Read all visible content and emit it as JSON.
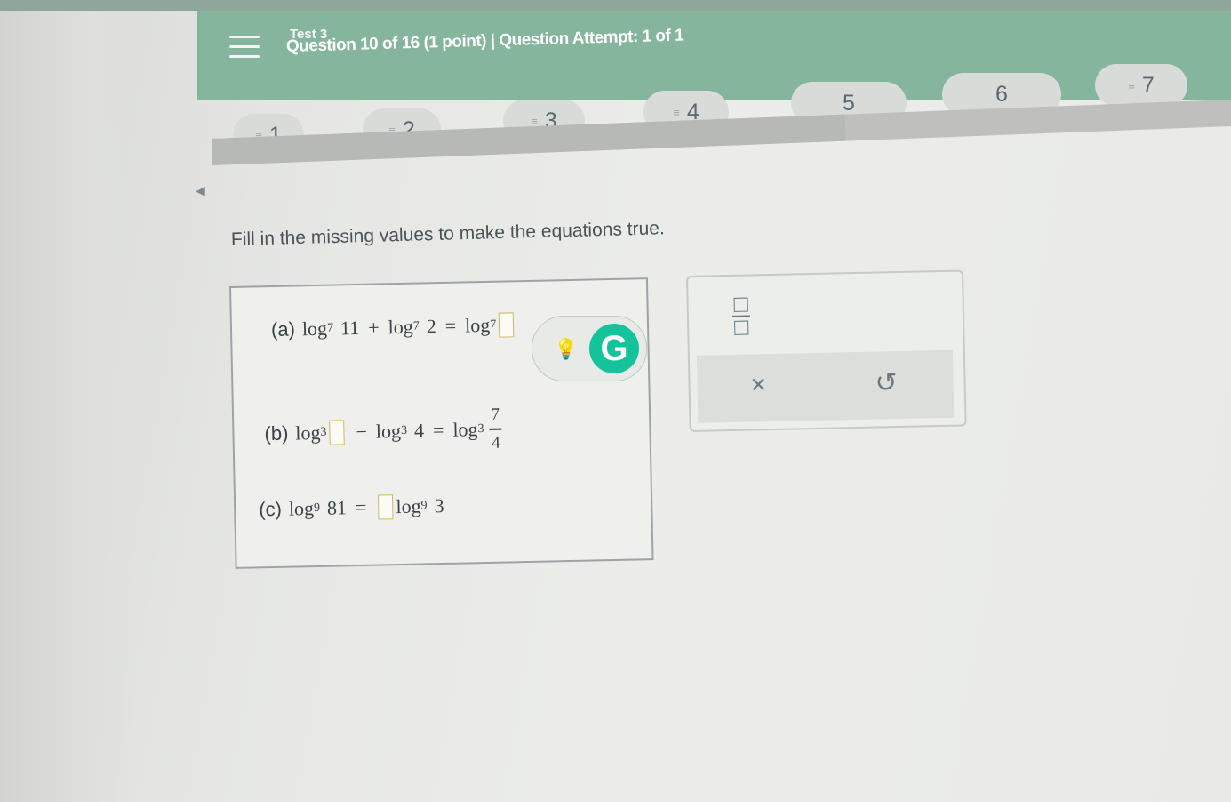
{
  "header": {
    "test_name": "Test 3",
    "question_info": "Question 10 of 16 (1 point)  |  Question Attempt: 1 of 1",
    "menu_icon": "hamburger-menu-icon"
  },
  "question_nav": [
    {
      "label": "1",
      "flagged": true
    },
    {
      "label": "2",
      "flagged": true
    },
    {
      "label": "3",
      "flagged": true
    },
    {
      "label": "4",
      "flagged": true
    },
    {
      "label": "5",
      "flagged": false
    },
    {
      "label": "6",
      "flagged": false
    },
    {
      "label": "7",
      "flagged": true
    }
  ],
  "question": {
    "instruction": "Fill in the missing values to make the equations true.",
    "a": {
      "label": "(a)",
      "t1": "log",
      "b1": "7",
      "a1": "11",
      "op1": "+",
      "t2": "log",
      "b2": "7",
      "a2": "2",
      "eq": "=",
      "t3": "log",
      "b3": "7"
    },
    "b": {
      "label": "(b)",
      "t1": "log",
      "b1": "3",
      "op1": "−",
      "t2": "log",
      "b2": "3",
      "a2": "4",
      "eq": "=",
      "t3": "log",
      "b3": "3",
      "num": "7",
      "den": "4"
    },
    "c": {
      "label": "(c)",
      "t1": "log",
      "b1": "9",
      "a1": "81",
      "eq": "=",
      "t2": "log",
      "b2": "9",
      "a2": "3"
    }
  },
  "tools": {
    "fraction_icon": "fraction-icon",
    "clear_symbol": "×",
    "undo_symbol": "↺"
  },
  "widget": {
    "logo_letter": "G",
    "bulb_symbol": "💡"
  },
  "colors": {
    "header_green": "#86b59d",
    "grammarly_green": "#15c39a"
  }
}
